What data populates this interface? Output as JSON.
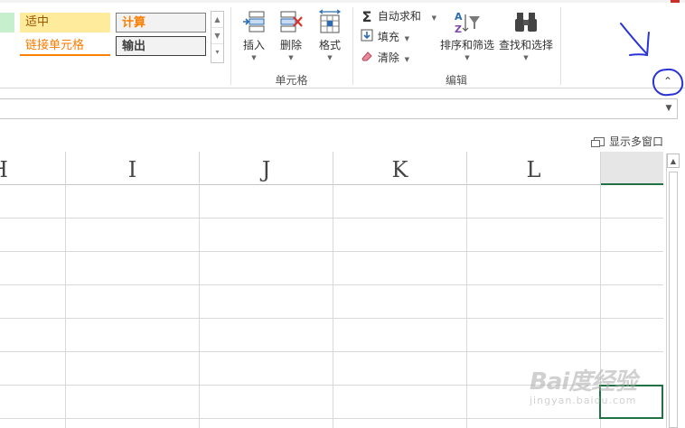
{
  "ribbon": {
    "styles": {
      "neutral": "适中",
      "calculation": "计算",
      "linked_cell": "链接单元格",
      "output": "输出"
    },
    "cells_group": {
      "label": "单元格",
      "insert": "插入",
      "delete": "删除",
      "format": "格式"
    },
    "editing_group": {
      "label": "编辑",
      "autosum": "自动求和",
      "fill": "填充",
      "clear": "清除",
      "sort_filter": "排序和筛选",
      "find_select": "查找和选择"
    },
    "icons": {
      "collapse": "chevron-up-icon",
      "scroll_up": "triangle-up-icon",
      "scroll_down": "triangle-down-icon",
      "more": "gallery-more-icon"
    }
  },
  "formula_bar": {
    "value": ""
  },
  "window": {
    "show_multiple_windows": "显示多窗口"
  },
  "grid": {
    "columns": [
      "H",
      "I",
      "J",
      "K",
      "L",
      ""
    ]
  },
  "watermark": {
    "main": "Bai度经验",
    "sub": "jingyan.baidu.com"
  },
  "colors": {
    "annotation": "#2a33d6",
    "selection": "#217346",
    "neutral_fill": "#ffeb9c",
    "calc_text": "#fa7d00"
  }
}
